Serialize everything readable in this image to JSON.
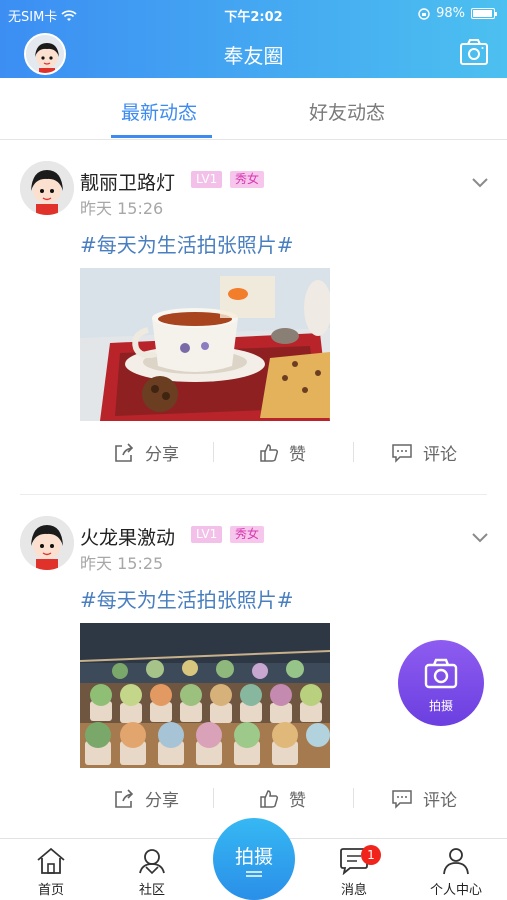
{
  "status_bar": {
    "carrier": "无SIM卡",
    "time": "下午2:02",
    "battery": "98%"
  },
  "header": {
    "title": "奉友圈"
  },
  "tabs": [
    {
      "label": "最新动态",
      "active": true
    },
    {
      "label": "好友动态",
      "active": false
    }
  ],
  "posts": [
    {
      "username": "靓丽卫路灯",
      "level": "LV1",
      "tag": "秀女",
      "time": "昨天 15:26",
      "topic": "#每天为生活拍张照片#"
    },
    {
      "username": "火龙果激动",
      "level": "LV1",
      "tag": "秀女",
      "time": "昨天 15:25",
      "topic": "#每天为生活拍张照片#"
    }
  ],
  "post_actions": {
    "share": "分享",
    "like": "赞",
    "comment": "评论"
  },
  "fab": {
    "label": "拍摄"
  },
  "bottom_nav": {
    "home": "首页",
    "community": "社区",
    "shoot": "拍摄",
    "messages": "消息",
    "messages_badge": "1",
    "profile": "个人中心"
  },
  "colors": {
    "accent": "#3d8bf0",
    "topic": "#4a7fbf",
    "fab": "#7b4ae8",
    "badge_red": "#f0241b"
  }
}
